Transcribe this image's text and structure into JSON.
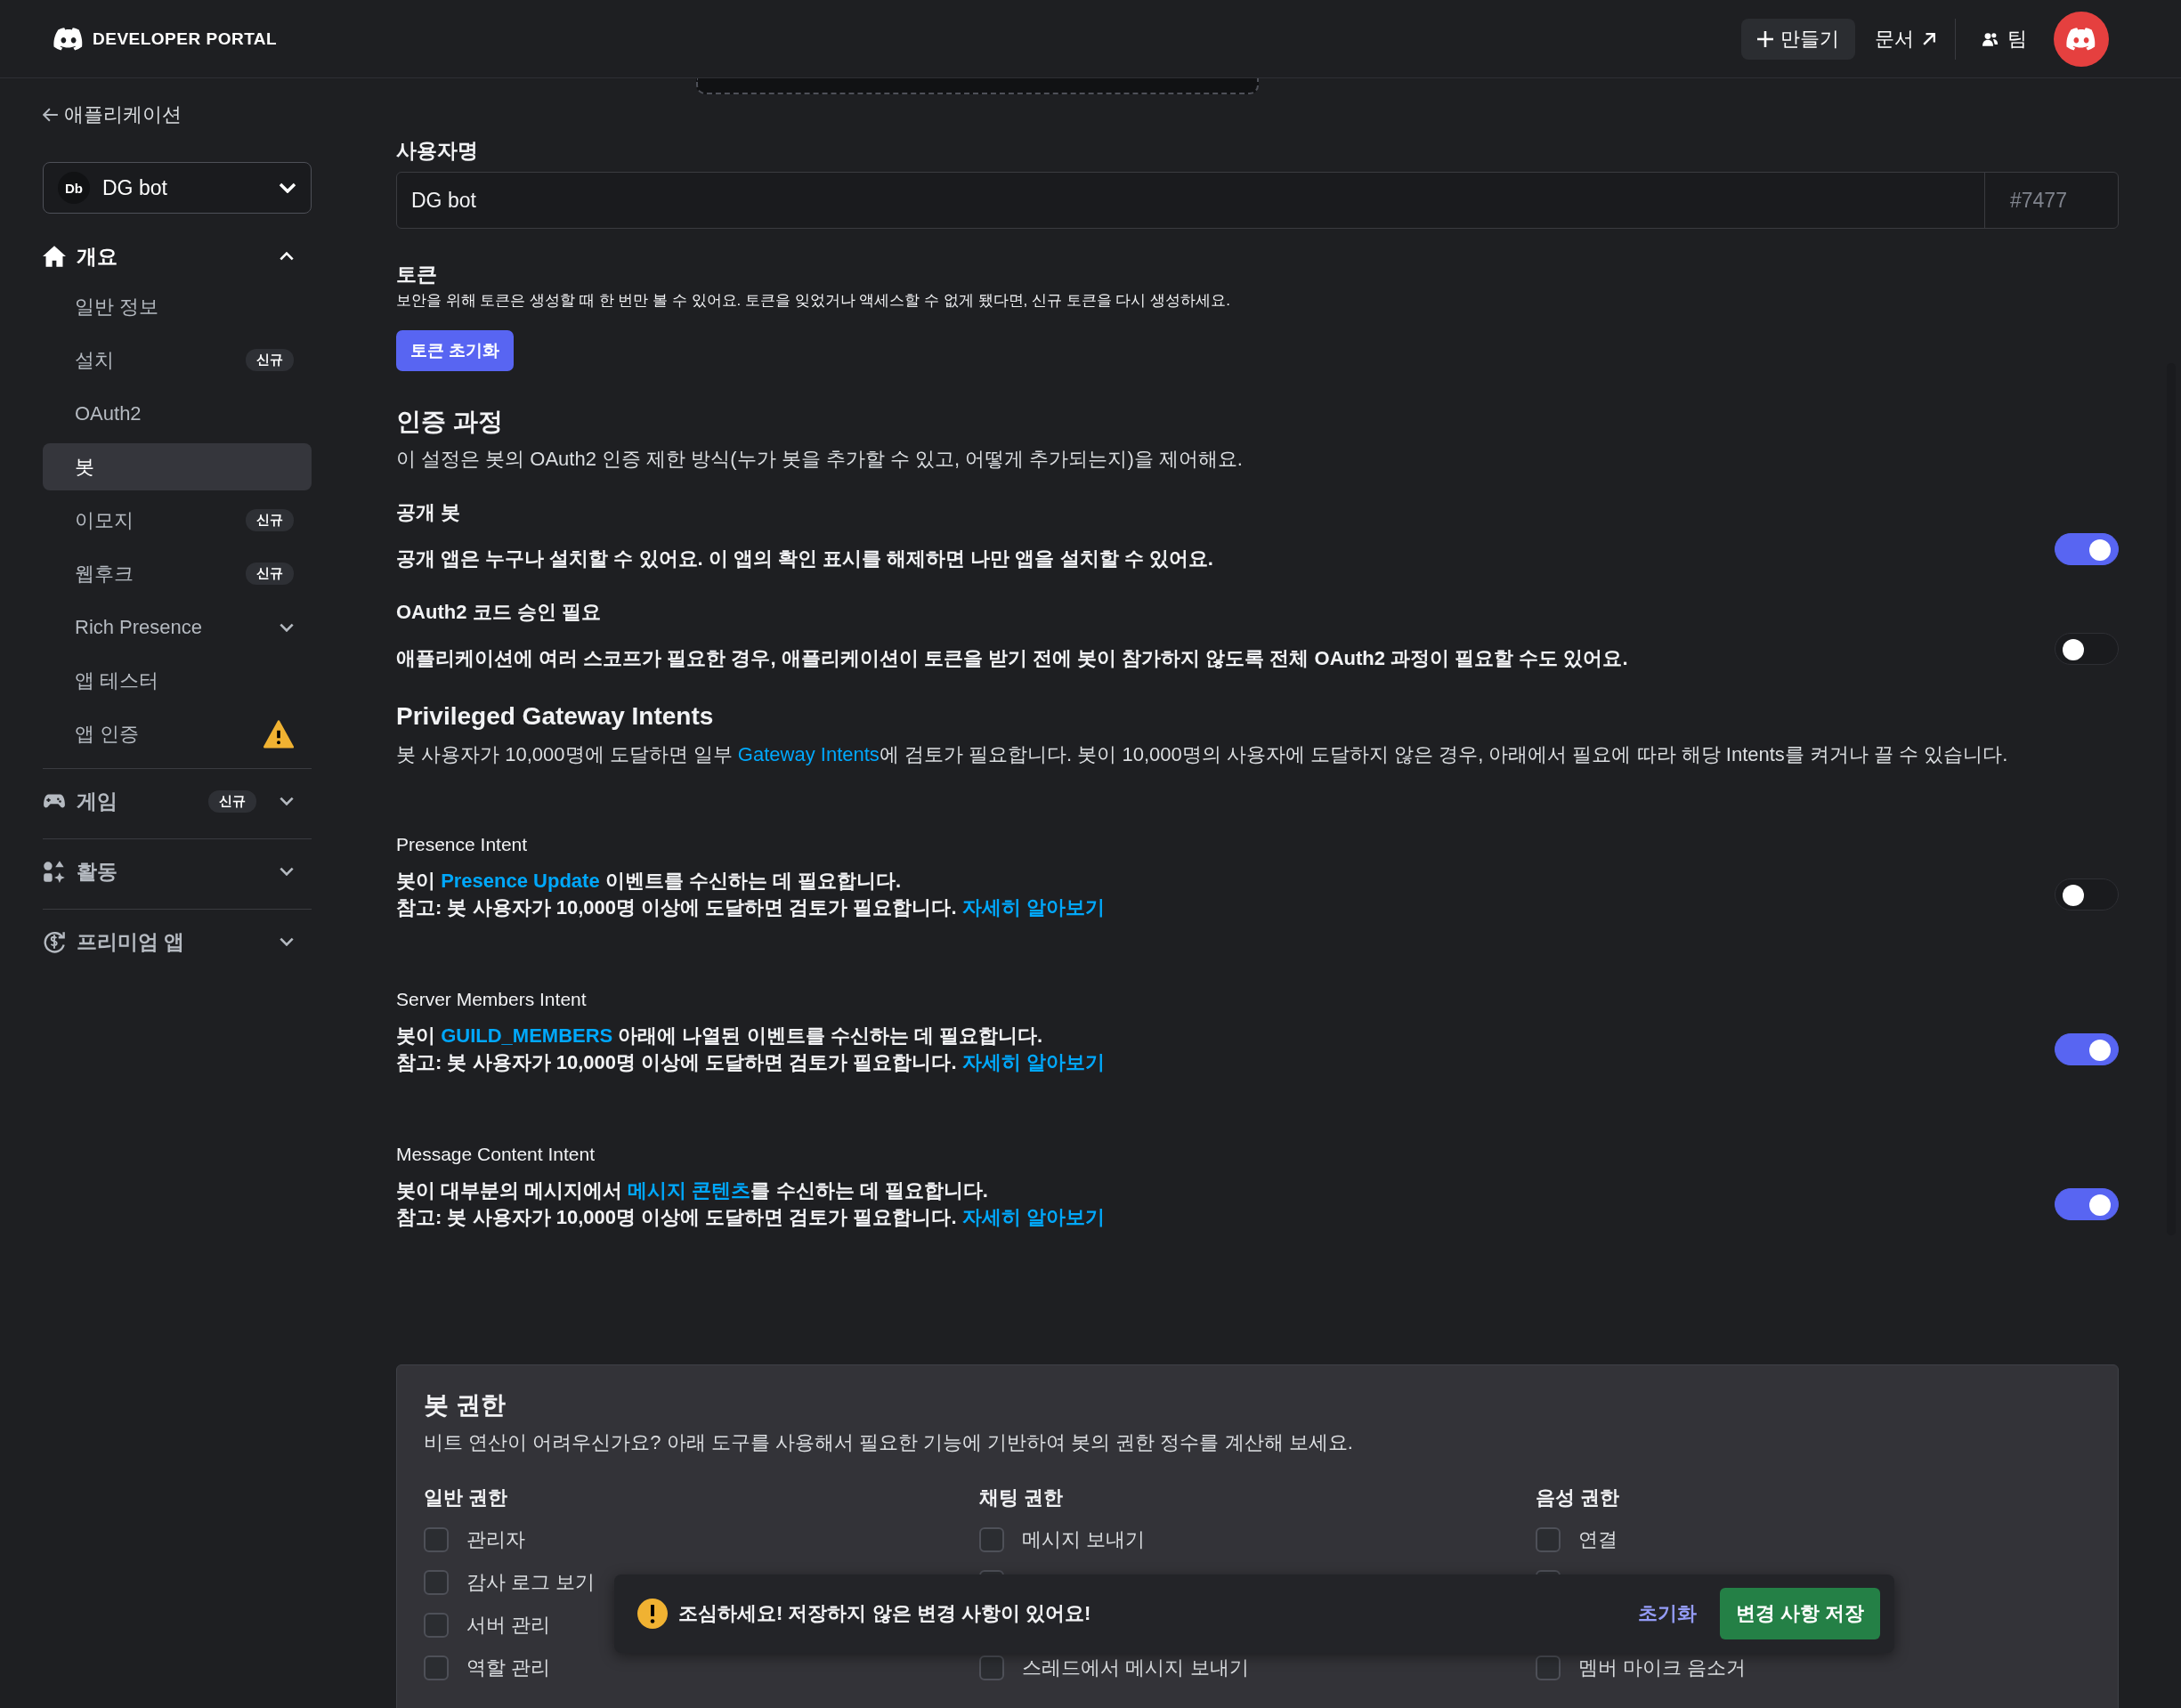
{
  "header": {
    "brand": "DEVELOPER PORTAL",
    "create_button": "만들기",
    "docs_link": "문서",
    "team_button": "팀"
  },
  "sidebar": {
    "back_link": "애플리케이션",
    "app_select": {
      "initials": "Db",
      "name": "DG bot"
    },
    "sections": [
      {
        "label": "개요",
        "expanded": true,
        "children": [
          {
            "label": "일반 정보",
            "selected": false
          },
          {
            "label": "설치",
            "badge": "신규",
            "selected": false
          },
          {
            "label": "OAuth2",
            "selected": false
          },
          {
            "label": "봇",
            "selected": true
          },
          {
            "label": "이모지",
            "badge": "신규",
            "selected": false
          },
          {
            "label": "웹후크",
            "badge": "신규",
            "selected": false
          },
          {
            "label": "Rich Presence",
            "selected": false,
            "expanded": false
          },
          {
            "label": "앱 테스터",
            "selected": false
          },
          {
            "label": "앱 인증",
            "selected": false,
            "warning": true
          }
        ]
      },
      {
        "label": "게임",
        "badge": "신규",
        "expanded": false
      },
      {
        "label": "활동",
        "expanded": false
      },
      {
        "label": "프리미엄 앱",
        "expanded": false
      }
    ]
  },
  "main": {
    "username": {
      "label": "사용자명",
      "value": "DG bot",
      "discriminator": "#7477"
    },
    "token": {
      "title": "토큰",
      "description": "보안을 위해 토큰은 생성할 때 한 번만 볼 수 있어요. 토큰을 잊었거나 액세스할 수 없게 됐다면, 신규 토큰을 다시 생성하세요.",
      "button": "토큰 초기화"
    },
    "auth_flow": {
      "title": "인증 과정",
      "description": "이 설정은 봇의 OAuth2 인증 제한 방식(누가 봇을 추가할 수 있고, 어떻게 추가되는지)을 제어해요.",
      "settings": [
        {
          "title": "공개 봇",
          "description": "공개 앱은 누구나 설치할 수 있어요. 이 앱의 확인 표시를 해제하면 나만 앱을 설치할 수 있어요.",
          "on": true
        },
        {
          "title": "OAuth2 코드 승인 필요",
          "description": "애플리케이션에 여러 스코프가 필요한 경우, 애플리케이션이 토큰을 받기 전에 봇이 참가하지 않도록 전체 OAuth2 과정이 필요할 수도 있어요.",
          "on": false
        }
      ]
    },
    "intents": {
      "title": "Privileged Gateway Intents",
      "description": [
        {
          "text": "봇 사용자가 10,000명에 도달하면 일부 ",
          "link": false
        },
        {
          "text": "Gateway Intents",
          "link": true
        },
        {
          "text": "에 검토가 필요합니다. 봇이 10,000명의 사용자에 도달하지 않은 경우, 아래에서 필요에 따라 해당 Intents를 켜거나 끌 수 있습니다.",
          "link": false
        }
      ],
      "items": [
        {
          "title": "Presence Intent",
          "on": false,
          "lines": [
            [
              {
                "text": "봇이 ",
                "link": false
              },
              {
                "text": "Presence Update",
                "link": true
              },
              {
                "text": " 이벤트를 수신하는 데 필요합니다.",
                "link": false
              }
            ],
            [
              {
                "text": "참고: 봇 사용자가 10,000명 이상에 도달하면 검토가 필요합니다. ",
                "link": false
              },
              {
                "text": "자세히 알아보기",
                "link": true
              }
            ]
          ]
        },
        {
          "title": "Server Members Intent",
          "on": true,
          "lines": [
            [
              {
                "text": "봇이 ",
                "link": false
              },
              {
                "text": "GUILD_MEMBERS",
                "link": true
              },
              {
                "text": " 아래에 나열된 이벤트를 수신하는 데 필요합니다.",
                "link": false
              }
            ],
            [
              {
                "text": "참고: 봇 사용자가 10,000명 이상에 도달하면 검토가 필요합니다. ",
                "link": false
              },
              {
                "text": "자세히 알아보기",
                "link": true
              }
            ]
          ]
        },
        {
          "title": "Message Content Intent",
          "on": true,
          "lines": [
            [
              {
                "text": "봇이 대부분의 메시지에서 ",
                "link": false
              },
              {
                "text": "메시지 콘텐츠",
                "link": true
              },
              {
                "text": "를 수신하는 데 필요합니다.",
                "link": false
              }
            ],
            [
              {
                "text": "참고: 봇 사용자가 10,000명 이상에 도달하면 검토가 필요합니다. ",
                "link": false
              },
              {
                "text": "자세히 알아보기",
                "link": true
              }
            ]
          ]
        }
      ]
    },
    "permissions": {
      "title": "봇 권한",
      "description": "비트 연산이 어려우신가요? 아래 도구를 사용해서 필요한 기능에 기반하여 봇의 권한 정수를 계산해 보세요.",
      "groups": [
        {
          "title": "일반 권한",
          "items": [
            {
              "kind": "visible",
              "label": "관리자",
              "checked": false
            },
            {
              "kind": "visible",
              "label": "감사 로그 보기",
              "checked": false
            },
            {
              "kind": "visible",
              "label": "서버 관리",
              "checked": false
            },
            {
              "kind": "visible",
              "label": "역할 관리",
              "checked": false
            }
          ]
        },
        {
          "title": "채팅 권한",
          "items": [
            {
              "kind": "visible",
              "label": "메시지 보내기",
              "checked": false
            },
            {
              "kind": "covered",
              "checked": false
            },
            {
              "kind": "hidden"
            },
            {
              "kind": "visible",
              "label": "스레드에서 메시지 보내기",
              "checked": false
            }
          ]
        },
        {
          "title": "음성 권한",
          "items": [
            {
              "kind": "visible",
              "label": "연결",
              "checked": false
            },
            {
              "kind": "covered",
              "checked": false
            },
            {
              "kind": "hidden"
            },
            {
              "kind": "visible",
              "label": "멤버 마이크 음소거",
              "checked": false
            }
          ]
        }
      ]
    }
  },
  "toast": {
    "message": "조심하세요! 저장하지 않은 변경 사항이 있어요!",
    "reset_link": "초기화",
    "save_button": "변경 사항 저장"
  }
}
